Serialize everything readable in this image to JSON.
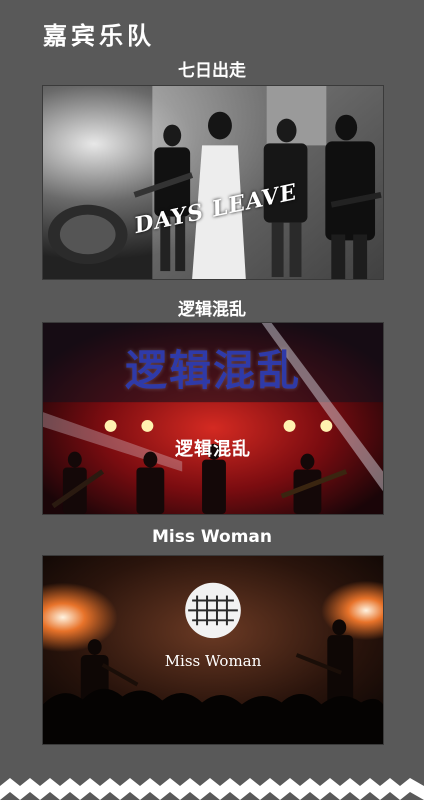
{
  "page": {
    "title": "嘉宾乐队"
  },
  "bands": [
    {
      "name": "七日出走",
      "logo_text": "DAYS LEAVE"
    },
    {
      "name": "逻辑混乱",
      "logo_text": "逻辑混乱",
      "stage_text": "逻辑混乱"
    },
    {
      "name": "Miss Woman",
      "logo_text": "Miss Woman"
    }
  ],
  "colors": {
    "background": "#595959",
    "text": "#ffffff",
    "band2_logo": "#2f3aa8",
    "stage_red": "#b3161a",
    "stage_orange": "#e8732a"
  }
}
